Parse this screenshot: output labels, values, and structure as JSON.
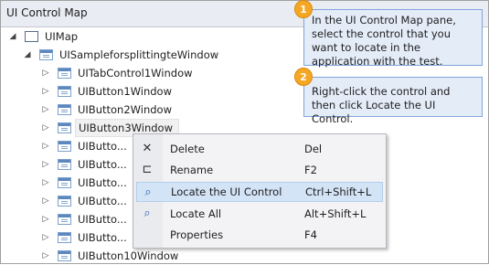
{
  "pane": {
    "title": "UI Control Map"
  },
  "tree": [
    {
      "label": "UIMap",
      "arrow": "◢",
      "icon": "map-icon"
    },
    {
      "label": "UISampleforsplittingteWindow",
      "arrow": "◢",
      "icon": "window-icon"
    },
    {
      "label": "UITabControl1Window",
      "arrow": "▷",
      "icon": "window-icon"
    },
    {
      "label": "UIButton1Window",
      "arrow": "▷",
      "icon": "window-icon"
    },
    {
      "label": "UIButton2Window",
      "arrow": "▷",
      "icon": "window-icon"
    },
    {
      "label": "UIButton3Window",
      "arrow": "▷",
      "icon": "window-icon"
    },
    {
      "label": "UIButto...",
      "arrow": "▷",
      "icon": "window-icon"
    },
    {
      "label": "UIButto...",
      "arrow": "▷",
      "icon": "window-icon"
    },
    {
      "label": "UIButto...",
      "arrow": "▷",
      "icon": "window-icon"
    },
    {
      "label": "UIButto...",
      "arrow": "▷",
      "icon": "window-icon"
    },
    {
      "label": "UIButto...",
      "arrow": "▷",
      "icon": "window-icon"
    },
    {
      "label": "UIButto...",
      "arrow": "▷",
      "icon": "window-icon"
    },
    {
      "label": "UIButton10Window",
      "arrow": "▷",
      "icon": "window-icon"
    }
  ],
  "callouts": [
    {
      "number": "1",
      "text": "In the UI Control Map pane, select the control that you want to locate in the application with the test."
    },
    {
      "number": "2",
      "text": "Right-click the control and then click Locate the UI Control."
    }
  ],
  "context_menu": [
    {
      "label": "Delete",
      "shortcut": "Del",
      "icon": "delete-icon",
      "glyph": "✕"
    },
    {
      "label": "Rename",
      "shortcut": "F2",
      "icon": "rename-icon",
      "glyph": "⊏"
    },
    {
      "label": "Locate the UI Control",
      "shortcut": "Ctrl+Shift+L",
      "icon": "locate-control-icon",
      "glyph": "⌕"
    },
    {
      "label": "Locate All",
      "shortcut": "Alt+Shift+L",
      "icon": "locate-all-icon",
      "glyph": "⌕"
    },
    {
      "label": "Properties",
      "shortcut": "F4",
      "icon": "",
      "glyph": ""
    }
  ],
  "colors": {
    "accent": "#f5a623",
    "highlight": "#d4e4f7",
    "callout_bg": "#e4ecf8"
  }
}
